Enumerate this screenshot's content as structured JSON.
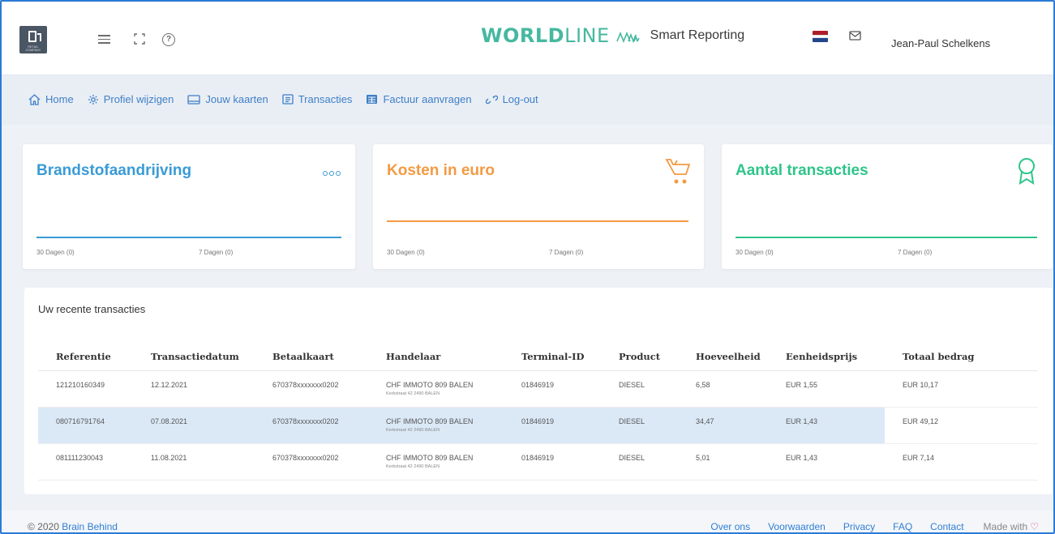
{
  "header": {
    "logo_caption": "RETAIL COMPANY",
    "brand_bold": "WORLD",
    "brand_thin": "LINE",
    "brand_sub": "Smart Reporting",
    "user_name": "Jean-Paul Schelkens",
    "flag_colors": [
      "#ae1c28",
      "#ffffff",
      "#21468b"
    ]
  },
  "nav": [
    {
      "label": "Home",
      "icon": "home-icon"
    },
    {
      "label": "Profiel wijzigen",
      "icon": "gear-icon"
    },
    {
      "label": "Jouw kaarten",
      "icon": "card-icon"
    },
    {
      "label": "Transacties",
      "icon": "list-icon"
    },
    {
      "label": "Factuur aanvragen",
      "icon": "invoice-icon"
    },
    {
      "label": "Log-out",
      "icon": "link-icon"
    }
  ],
  "cards": [
    {
      "title": "Brandstofaandrijving",
      "color": "#3a9bd6",
      "foot_30": "30 Dagen (0)",
      "foot_7": "7 Dagen (0)",
      "icon": "dots-icon"
    },
    {
      "title": "Kosten in euro",
      "color": "#f39a43",
      "foot_30": "30 Dagen (0)",
      "foot_7": "7 Dagen (0)",
      "icon": "cart-icon"
    },
    {
      "title": "Aantal transacties",
      "color": "#2fc58a",
      "foot_30": "30 Dagen (0)",
      "foot_7": "7 Dagen (0)",
      "icon": "award-icon"
    }
  ],
  "transactions": {
    "title": "Uw recente transacties",
    "columns": [
      "Referentie",
      "Transactiedatum",
      "Betaalkaart",
      "Handelaar",
      "Terminal-ID",
      "Product",
      "Hoeveelheid",
      "Eenheidsprijs",
      "Totaal bedrag"
    ],
    "rows": [
      {
        "ref": "121210160349",
        "date": "12.12.2021",
        "card": "670378xxxxxxx0202",
        "merchant": "CHF IMMOTO 809 BALEN",
        "address": "Kerkstraat 42 2490 BALEN",
        "terminal": "01846919",
        "product": "DIESEL",
        "qty": "6,58",
        "unit": "EUR 1,55",
        "total": "EUR 10,17"
      },
      {
        "ref": "080716791764",
        "date": "07.08.2021",
        "card": "670378xxxxxxx0202",
        "merchant": "CHF IMMOTO 809 BALEN",
        "address": "Kerkstraat 42 2490 BALEN",
        "terminal": "01846919",
        "product": "DIESEL",
        "qty": "34,47",
        "unit": "EUR 1,43",
        "total": "EUR 49,12"
      },
      {
        "ref": "081111230043",
        "date": "11.08.2021",
        "card": "670378xxxxxxx0202",
        "merchant": "CHF IMMOTO 809 BALEN",
        "address": "Kerkstraat 42 2490 BALEN",
        "terminal": "01846919",
        "product": "DIESEL",
        "qty": "5,01",
        "unit": "EUR 1,43",
        "total": "EUR 7,14"
      }
    ]
  },
  "footer": {
    "copyright": "© 2020",
    "company": "Brain Behind",
    "links": [
      "Over ons",
      "Voorwaarden",
      "Privacy",
      "FAQ",
      "Contact"
    ],
    "made_with": "Made with"
  }
}
